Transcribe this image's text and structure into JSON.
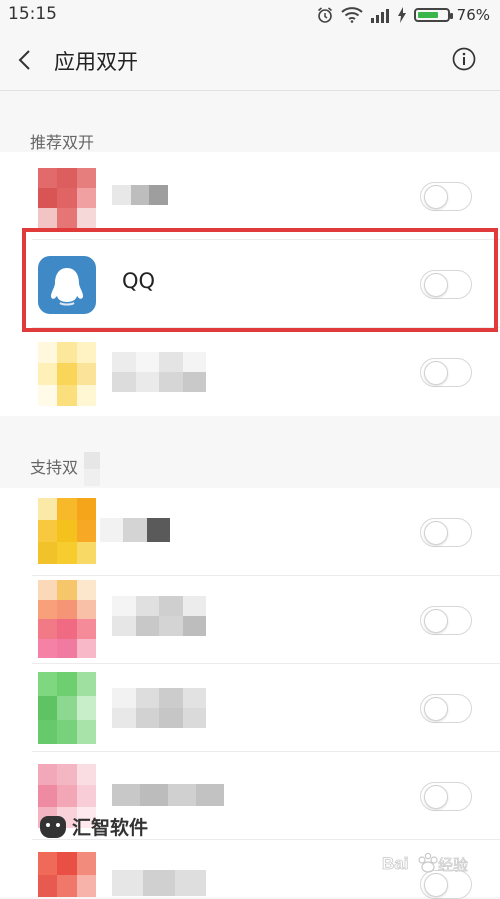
{
  "status_bar": {
    "time": "15:15",
    "battery_percent": "76%",
    "battery_level": 0.76
  },
  "header": {
    "title": "应用双开"
  },
  "sections": [
    {
      "label": "推荐双开"
    },
    {
      "label": "支持双"
    }
  ],
  "apps": [
    {
      "name": "",
      "enabled": false,
      "icon": "blurred-app-icon"
    },
    {
      "name": "QQ",
      "enabled": false,
      "icon": "qq-penguin-icon"
    },
    {
      "name": "",
      "enabled": false,
      "icon": "blurred-app-icon"
    },
    {
      "name": "",
      "enabled": false,
      "icon": "blurred-app-icon"
    },
    {
      "name": "",
      "enabled": false,
      "icon": "blurred-app-icon"
    },
    {
      "name": "",
      "enabled": false,
      "icon": "blurred-app-icon"
    },
    {
      "name": "",
      "enabled": false,
      "icon": "blurred-app-icon"
    },
    {
      "name": "",
      "enabled": false,
      "icon": "blurred-app-icon"
    }
  ],
  "watermark": {
    "text": "汇智软件",
    "logo_text": "Bai 经验"
  },
  "colors": {
    "highlight": "#e03a3a",
    "battery": "#39b54a",
    "qq_icon": "#3f89c6"
  }
}
